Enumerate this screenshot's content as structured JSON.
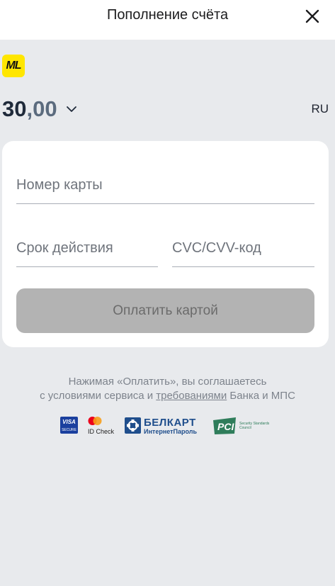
{
  "header": {
    "title": "Пополнение счёта",
    "close_icon": "close-icon"
  },
  "brand": {
    "logo_text": "ML",
    "logo_color": "#ffe600"
  },
  "amount": {
    "integer_part": "30",
    "fraction_part": ",00",
    "dropdown_icon": "chevron-down-icon"
  },
  "language": {
    "label": "RU"
  },
  "form": {
    "card_number_placeholder": "Номер карты",
    "expiry_placeholder": "Срок действия",
    "cvc_placeholder": "CVC/CVV-код",
    "pay_button_label": "Оплатить картой",
    "pay_button_color": "#b3b3b3"
  },
  "terms": {
    "line1": "Нажимая «Оплатить», вы соглашаетесь",
    "line2_prefix": "с условиями сервиса и ",
    "line2_link": "требованиями",
    "line2_suffix": " Банка и МПС"
  },
  "badges": {
    "visa_top": "VISA",
    "visa_bottom": "SECURE",
    "mastercard_label": "ID Check",
    "belkart_title": "БЕЛКАРТ",
    "belkart_subtitle": "ИнтернетПароль",
    "pci_logo": "PCI",
    "pci_text": "Security Standards Council"
  }
}
